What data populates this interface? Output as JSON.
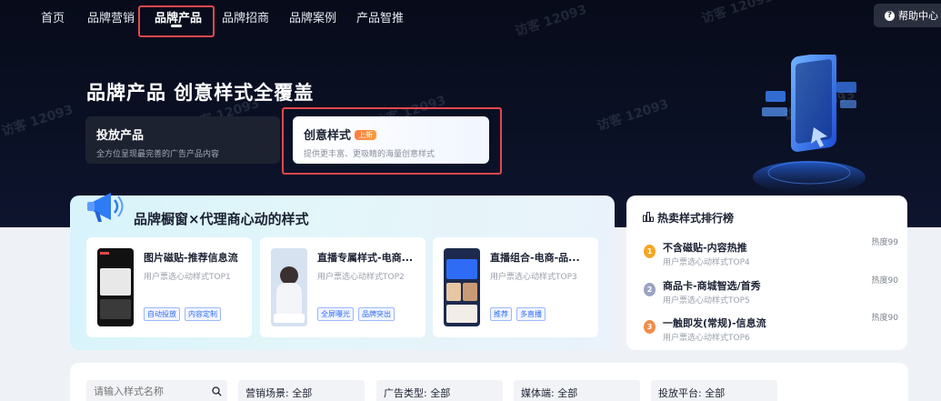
{
  "nav": {
    "items": [
      "首页",
      "品牌营销",
      "品牌产品",
      "品牌招商",
      "品牌案例",
      "产品智推"
    ],
    "active_index": 2,
    "help_label": "帮助中心"
  },
  "hero": {
    "title": "品牌产品 创意样式全覆盖",
    "tabs": [
      {
        "title": "投放产品",
        "subtitle": "全方位呈现最完善的广告产品内容"
      },
      {
        "title": "创意样式",
        "badge": "上新",
        "subtitle": "提供更丰富、更吸睛的海量创意样式"
      }
    ]
  },
  "showcase": {
    "title": "品牌橱窗×代理商心动的样式",
    "cards": [
      {
        "title": "图片磁贴-推荐信息流",
        "subtitle": "用户票选心动样式TOP1",
        "tags": [
          "自动投放",
          "内容定制"
        ]
      },
      {
        "title": "直播专属样式-电商...",
        "subtitle": "用户票选心动样式TOP2",
        "tags": [
          "全屏曝光",
          "品牌突出"
        ]
      },
      {
        "title": "直播组合-电商-品...",
        "subtitle": "用户票选心动样式TOP3",
        "tags": [
          "推荐",
          "多直播"
        ]
      }
    ]
  },
  "ranking": {
    "title": "热卖样式排行榜",
    "items": [
      {
        "rank": "1",
        "name": "不含磁贴-内容热推",
        "subtitle": "用户票选心动样式TOP4",
        "heat": "热度99"
      },
      {
        "rank": "2",
        "name": "商品卡-商城智选/首秀",
        "subtitle": "用户票选心动样式TOP5",
        "heat": "热度90"
      },
      {
        "rank": "3",
        "name": "一触即发(常规)-信息流",
        "subtitle": "用户票选心动样式TOP6",
        "heat": "热度90"
      }
    ]
  },
  "filters": {
    "search_placeholder": "请输入样式名称",
    "selects": [
      "营销场景: 全部",
      "广告类型: 全部",
      "媒体端: 全部",
      "投放平台: 全部"
    ]
  },
  "watermark": "访客 12093",
  "colors": {
    "accent": "#2f6cf6",
    "highlight": "#e5484d",
    "badge": "#ff7a3d",
    "medal_gold": "#f5a623",
    "medal_silver": "#9aa3c2",
    "medal_bronze": "#f08c4a"
  }
}
